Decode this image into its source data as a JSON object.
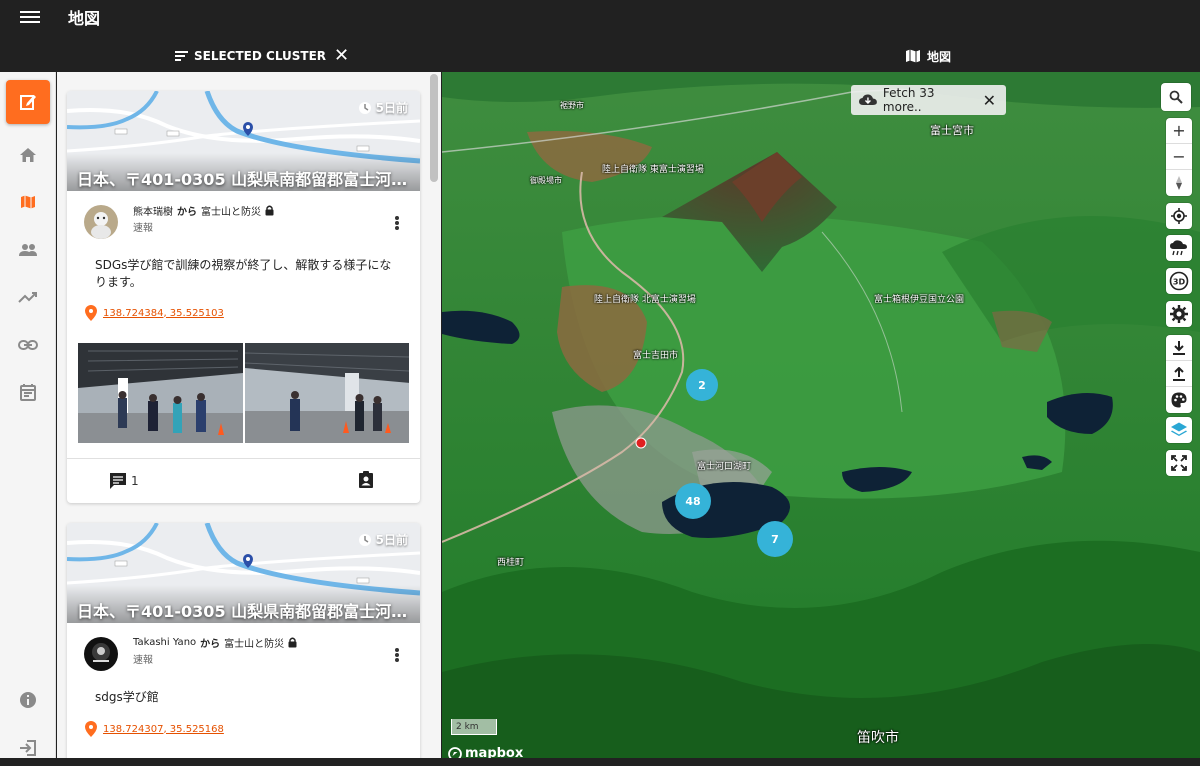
{
  "app": {
    "title": "地図"
  },
  "tabs": {
    "cluster": "SELECTED CLUSTER",
    "map": "地図"
  },
  "cards": [
    {
      "time": "5日前",
      "address": "日本、〒401-0305 山梨県南都留郡富士河…",
      "author": "熊本瑞樹",
      "from": "から",
      "group": "富士山と防災",
      "kind": "速報",
      "message": "SDGs学び館で訓練の視察が終了し、解散する様子になります。",
      "location": "138.724384, 35.525103",
      "comments": "1"
    },
    {
      "time": "5日前",
      "address": "日本、〒401-0305 山梨県南都留郡富士河…",
      "author": "Takashi Yano",
      "from": "から",
      "group": "富士山と防災",
      "kind": "速報",
      "message": "sdgs学び館",
      "location": "138.724307, 35.525168"
    }
  ],
  "map": {
    "fetch_label": "Fetch 33 more..",
    "clusters": [
      "2",
      "48",
      "7"
    ],
    "labels": [
      "富士宮市",
      "陸上自衛隊 東富士演習場",
      "陸上自衛隊 北富士演習場",
      "富士吉田市",
      "富士箱根伊豆国立公園",
      "富士河口湖町",
      "西桂町",
      "笛吹市",
      "御殿場市",
      "裾野市"
    ],
    "scale": "2 km",
    "attribution": "mapbox"
  },
  "colors": {
    "accent": "#ff6d1f",
    "cluster": "#35b3d8",
    "link": "#e65100"
  }
}
